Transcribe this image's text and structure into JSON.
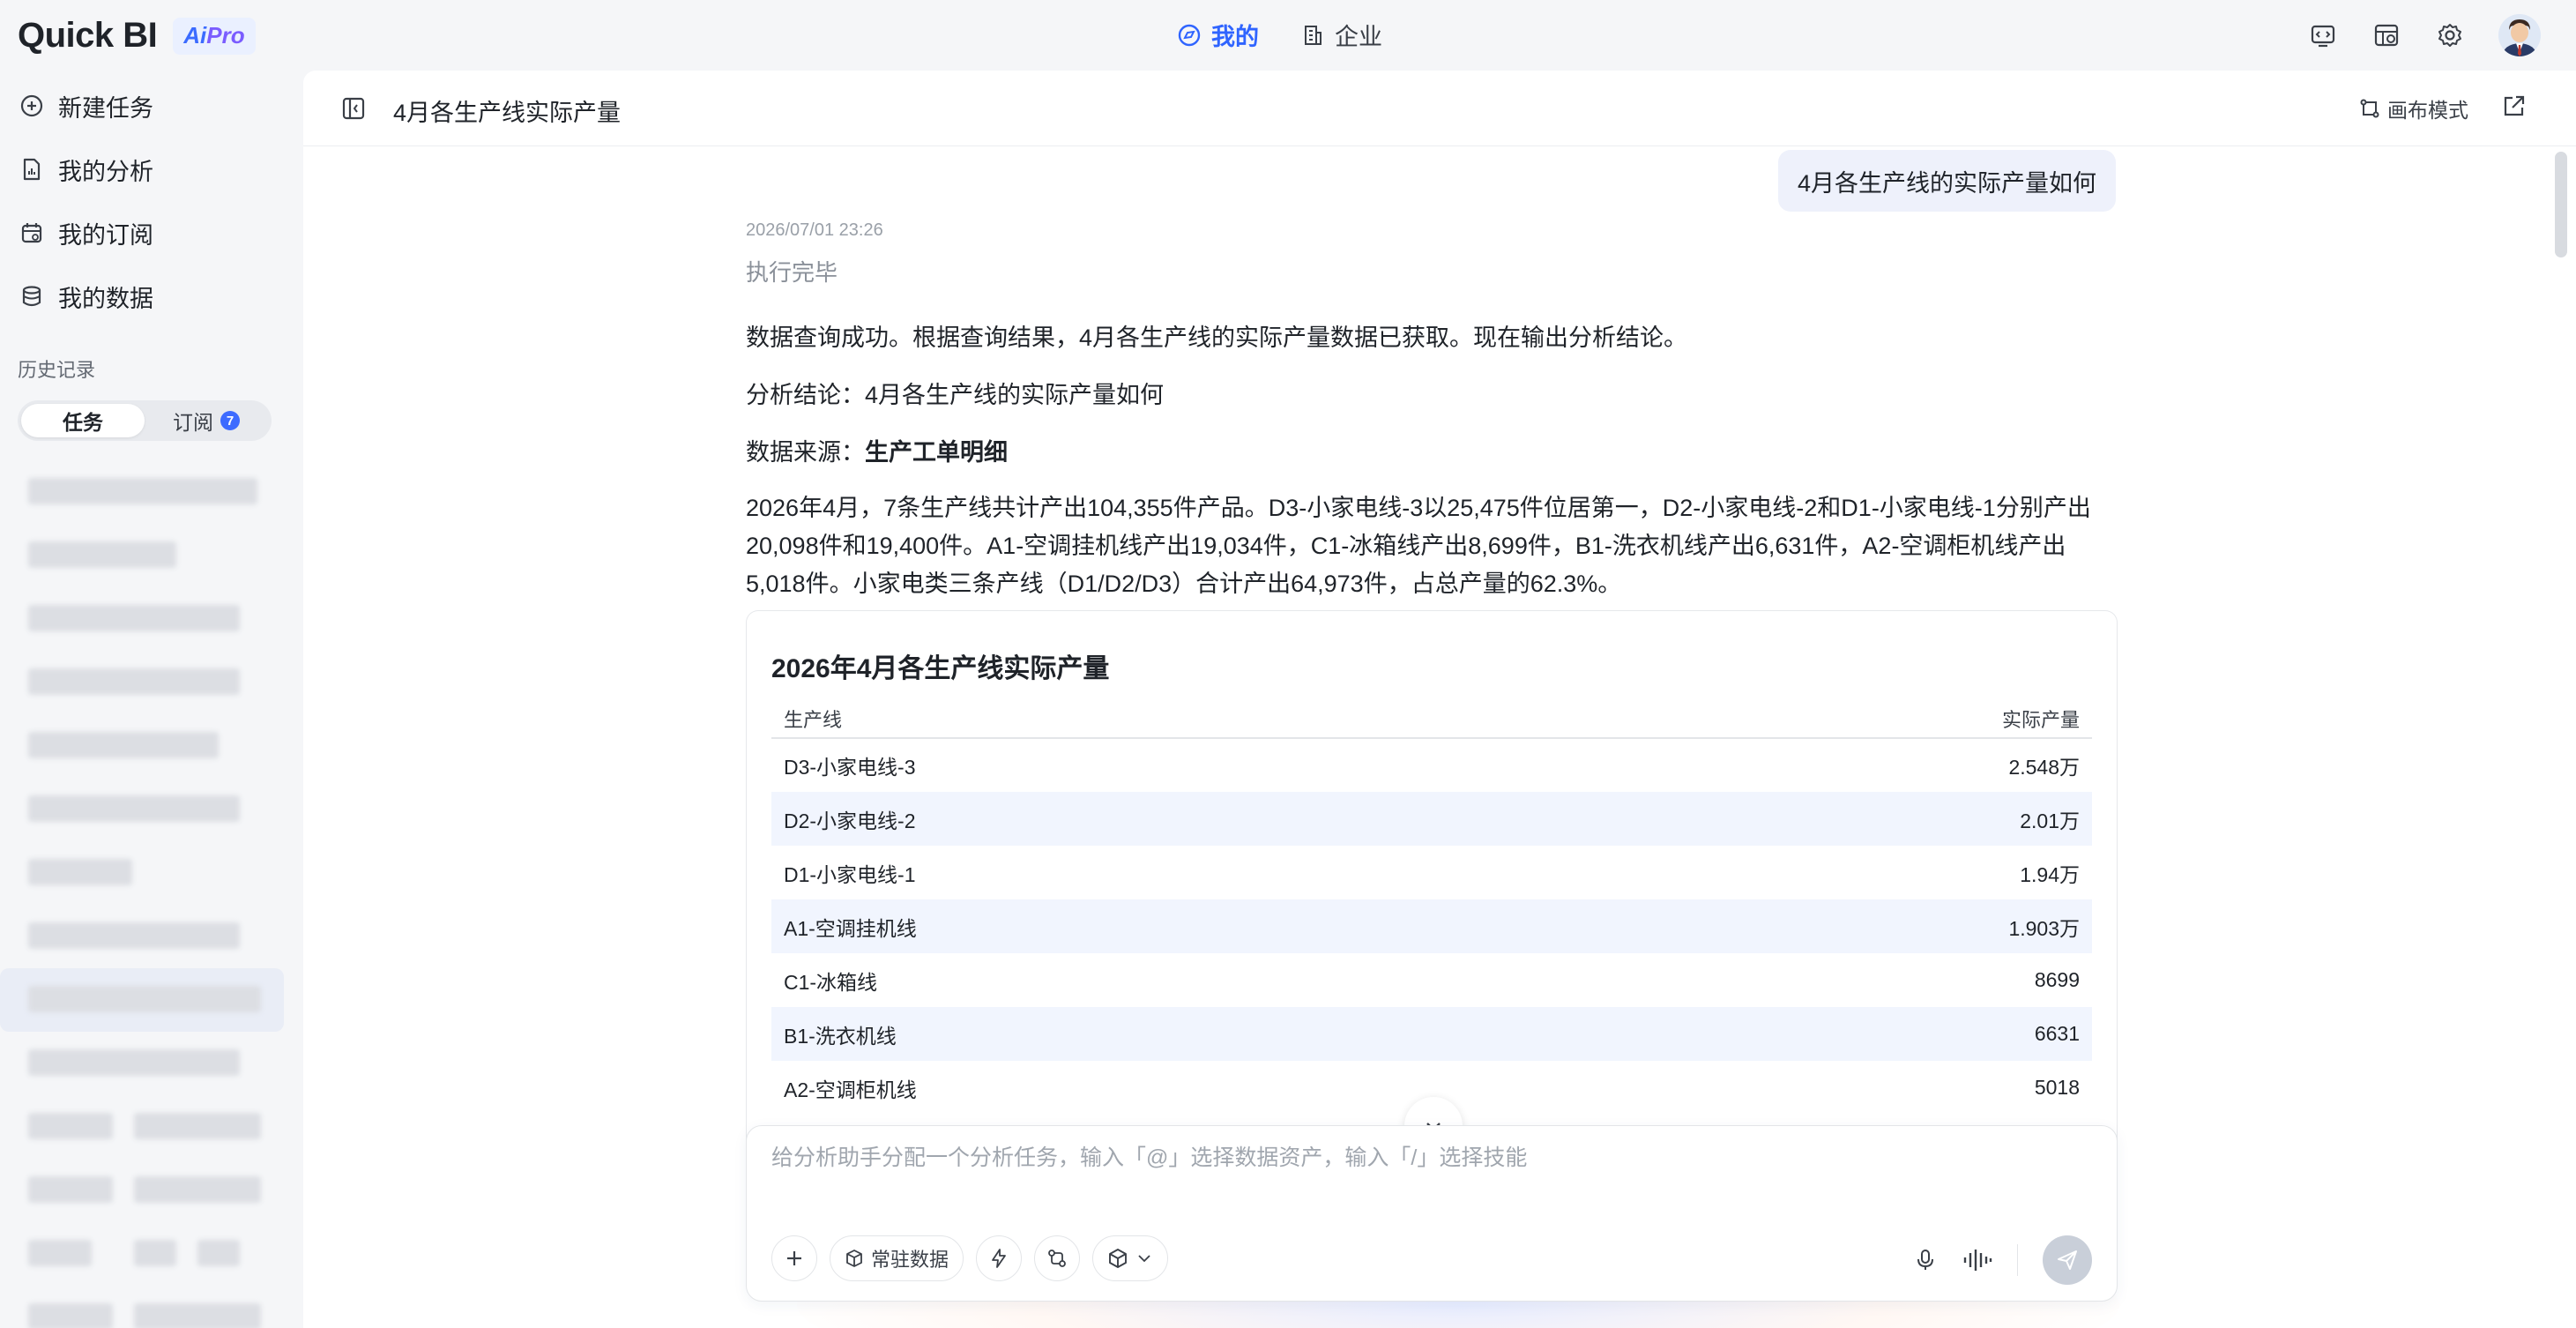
{
  "header": {
    "logo": "Quick BI",
    "badge_ai": "Ai",
    "badge_pro": "Pro",
    "tabs": [
      {
        "label": "我的",
        "icon": "compass-icon",
        "active": true
      },
      {
        "label": "企业",
        "icon": "building-icon",
        "active": false
      }
    ],
    "icons": [
      "code-icon",
      "table-icon",
      "gear-icon",
      "avatar"
    ],
    "accent_color": "#2f64ff"
  },
  "sidebar": {
    "nav": [
      {
        "label": "新建任务",
        "icon": "plus-circle-icon"
      },
      {
        "label": "我的分析",
        "icon": "document-chart-icon"
      },
      {
        "label": "我的订阅",
        "icon": "calendar-icon"
      },
      {
        "label": "我的数据",
        "icon": "database-icon"
      }
    ],
    "history_label": "历史记录",
    "segment": {
      "task": "任务",
      "subscribe": "订阅",
      "badge": "7"
    }
  },
  "main": {
    "title": "4月各生产线实际产量",
    "canvas_mode": "画布模式",
    "user_question": "4月各生产线的实际产量如何",
    "timestamp": "2026/07/01 23:26",
    "status": "执行完毕",
    "para1": "数据查询成功。根据查询结果，4月各生产线的实际产量数据已获取。现在输出分析结论。",
    "conclusion_label": "分析结论：",
    "conclusion": "4月各生产线的实际产量如何",
    "source_label": "数据来源：",
    "source": "生产工单明细",
    "summary": "2026年4月，7条生产线共计产出104,355件产品。D3-小家电线-3以25,475件位居第一，D2-小家电线-2和D1-小家电线-1分别产出20,098件和19,400件。A1-空调挂机线产出19,034件，C1-冰箱线产出8,699件，B1-洗衣机线产出6,631件，A2-空调柜机线产出5,018件。小家电类三条产线（D1/D2/D3）合计产出64,973件，占总产量的62.3%。"
  },
  "table": {
    "title": "2026年4月各生产线实际产量",
    "col_line": "生产线",
    "col_output": "实际产量",
    "rows": [
      {
        "line": "D3-小家电线-3",
        "output": "2.548万"
      },
      {
        "line": "D2-小家电线-2",
        "output": "2.01万"
      },
      {
        "line": "D1-小家电线-1",
        "output": "1.94万"
      },
      {
        "line": "A1-空调挂机线",
        "output": "1.903万"
      },
      {
        "line": "C1-冰箱线",
        "output": "8699"
      },
      {
        "line": "B1-洗衣机线",
        "output": "6631"
      },
      {
        "line": "A2-空调柜机线",
        "output": "5018"
      }
    ]
  },
  "composer": {
    "placeholder": "给分析助手分配一个分析任务，输入「@」选择数据资产，输入「/」选择技能",
    "resident_data": "常驻数据",
    "tools": [
      "plus-icon",
      "cube-icon",
      "lightning-icon",
      "flow-icon",
      "box-dropdown-icon"
    ],
    "right_tools": [
      "microphone-icon",
      "waveform-icon",
      "send-icon"
    ]
  }
}
